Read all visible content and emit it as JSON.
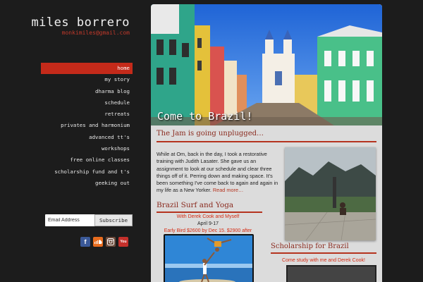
{
  "site": {
    "title": "miles borrero",
    "email": "monkimiles@gmail.com"
  },
  "nav": {
    "items": [
      {
        "label": "home",
        "active": true
      },
      {
        "label": "my story"
      },
      {
        "label": "dharma blog"
      },
      {
        "label": "schedule"
      },
      {
        "label": "retreats"
      },
      {
        "label": "privates and harmonium"
      },
      {
        "label": "advanced tt's"
      },
      {
        "label": "workshops"
      },
      {
        "label": "free online classes"
      },
      {
        "label": "scholarship fund and t's"
      },
      {
        "label": "geeking out"
      }
    ]
  },
  "subscribe": {
    "placeholder": "Email Address",
    "button_label": "Subscribe"
  },
  "social": {
    "icons": [
      "facebook-icon",
      "soundcloud-icon",
      "instagram-icon",
      "youtube-icon"
    ],
    "facebook": "f",
    "youtube": "You"
  },
  "hero": {
    "caption": "Come to Brazil!"
  },
  "post": {
    "title": "The Jam is going unplugged…",
    "body": "While at Om, back in the day, I took a restorative training with Judith Lasater. She gave us an assignment to look at our schedule and clear three things off of it. Perring down and making space. It's been something I've come back to again and again in my life as a New Yorker. ",
    "read_more": "Read more…"
  },
  "brazil": {
    "title": "Brazil Surf and Yoga",
    "line1": "With Derek Cook and Myself",
    "line2": "April 9-17",
    "line3": "Early Bird $2600 by Dec 15.  $2900 after"
  },
  "scholarship": {
    "title": "Scholarship for Brazil",
    "subtitle": "Come study with me and Derek Cook!"
  },
  "colors": {
    "accent": "#c42a1a",
    "background": "#1c1c1c",
    "content_bg": "#dcdcdc",
    "heading": "#8a2a1e"
  }
}
